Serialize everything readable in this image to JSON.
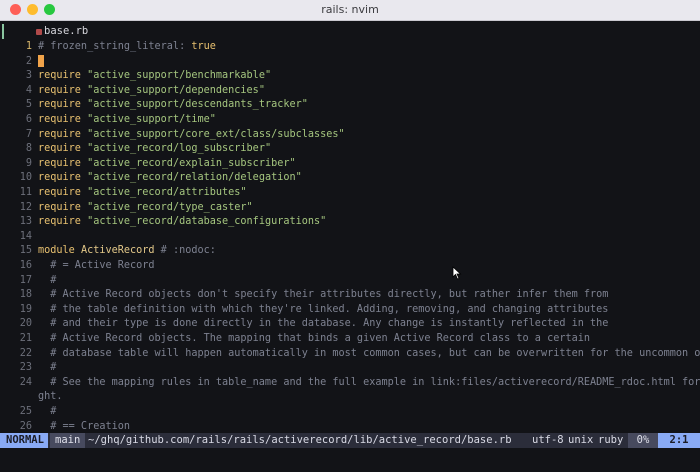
{
  "window": {
    "title": "rails: nvim"
  },
  "tab": {
    "filename": "base.rb"
  },
  "lines": [
    {
      "n": "1",
      "current": true,
      "segs": [
        [
          "c",
          "# frozen_string_literal: "
        ],
        [
          "kw",
          "true"
        ]
      ]
    },
    {
      "n": "2",
      "cursor": true,
      "segs": []
    },
    {
      "n": "3",
      "segs": [
        [
          "kw",
          "require "
        ],
        [
          "str",
          "\"active_support/benchmarkable\""
        ]
      ]
    },
    {
      "n": "4",
      "segs": [
        [
          "kw",
          "require "
        ],
        [
          "str",
          "\"active_support/dependencies\""
        ]
      ]
    },
    {
      "n": "5",
      "segs": [
        [
          "kw",
          "require "
        ],
        [
          "str",
          "\"active_support/descendants_tracker\""
        ]
      ]
    },
    {
      "n": "6",
      "segs": [
        [
          "kw",
          "require "
        ],
        [
          "str",
          "\"active_support/time\""
        ]
      ]
    },
    {
      "n": "7",
      "segs": [
        [
          "kw",
          "require "
        ],
        [
          "str",
          "\"active_support/core_ext/class/subclasses\""
        ]
      ]
    },
    {
      "n": "8",
      "segs": [
        [
          "kw",
          "require "
        ],
        [
          "str",
          "\"active_record/log_subscriber\""
        ]
      ]
    },
    {
      "n": "9",
      "segs": [
        [
          "kw",
          "require "
        ],
        [
          "str",
          "\"active_record/explain_subscriber\""
        ]
      ]
    },
    {
      "n": "10",
      "segs": [
        [
          "kw",
          "require "
        ],
        [
          "str",
          "\"active_record/relation/delegation\""
        ]
      ]
    },
    {
      "n": "11",
      "segs": [
        [
          "kw",
          "require "
        ],
        [
          "str",
          "\"active_record/attributes\""
        ]
      ]
    },
    {
      "n": "12",
      "segs": [
        [
          "kw",
          "require "
        ],
        [
          "str",
          "\"active_record/type_caster\""
        ]
      ]
    },
    {
      "n": "13",
      "segs": [
        [
          "kw",
          "require "
        ],
        [
          "str",
          "\"active_record/database_configurations\""
        ]
      ]
    },
    {
      "n": "14",
      "segs": []
    },
    {
      "n": "15",
      "segs": [
        [
          "kw",
          "module "
        ],
        [
          "cons",
          "ActiveRecord "
        ],
        [
          "c",
          "# :nodoc:"
        ]
      ]
    },
    {
      "n": "16",
      "segs": [
        [
          "c",
          "  # = Active Record"
        ]
      ]
    },
    {
      "n": "17",
      "segs": [
        [
          "c",
          "  #"
        ]
      ]
    },
    {
      "n": "18",
      "segs": [
        [
          "c",
          "  # Active Record objects don't specify their attributes directly, but rather infer them from"
        ]
      ]
    },
    {
      "n": "19",
      "segs": [
        [
          "c",
          "  # the table definition with which they're linked. Adding, removing, and changing attributes"
        ]
      ]
    },
    {
      "n": "20",
      "segs": [
        [
          "c",
          "  # and their type is done directly in the database. Any change is instantly reflected in the"
        ]
      ]
    },
    {
      "n": "21",
      "segs": [
        [
          "c",
          "  # Active Record objects. The mapping that binds a given Active Record class to a certain"
        ]
      ]
    },
    {
      "n": "22",
      "segs": [
        [
          "c",
          "  # database table will happen automatically in most common cases, but can be overwritten for the uncommon ones."
        ]
      ]
    },
    {
      "n": "23",
      "segs": [
        [
          "c",
          "  #"
        ]
      ]
    },
    {
      "n": "24",
      "segs": [
        [
          "c",
          "  # See the mapping rules in table_name and the full example in link:files/activerecord/README_rdoc.html for more insi"
        ]
      ]
    },
    {
      "n": "",
      "segs": [
        [
          "c",
          "ght."
        ]
      ]
    },
    {
      "n": "25",
      "segs": [
        [
          "c",
          "  #"
        ]
      ]
    },
    {
      "n": "26",
      "segs": [
        [
          "c",
          "  # == Creation"
        ]
      ]
    }
  ],
  "status": {
    "mode": "NORMAL",
    "branch": "main",
    "path": "~/ghq/github.com/rails/rails/activerecord/lib/active_record/base.rb",
    "encoding": "utf-8",
    "fileformat": "unix",
    "filetype": "ruby",
    "percent": "0%",
    "position": "2:1"
  },
  "colors": {
    "background": "#121317",
    "keyword": "#e8c170",
    "string": "#a5c67f",
    "comment": "#7d8190",
    "mode_bg": "#89aaf5",
    "cursor": "#f0a34a"
  }
}
